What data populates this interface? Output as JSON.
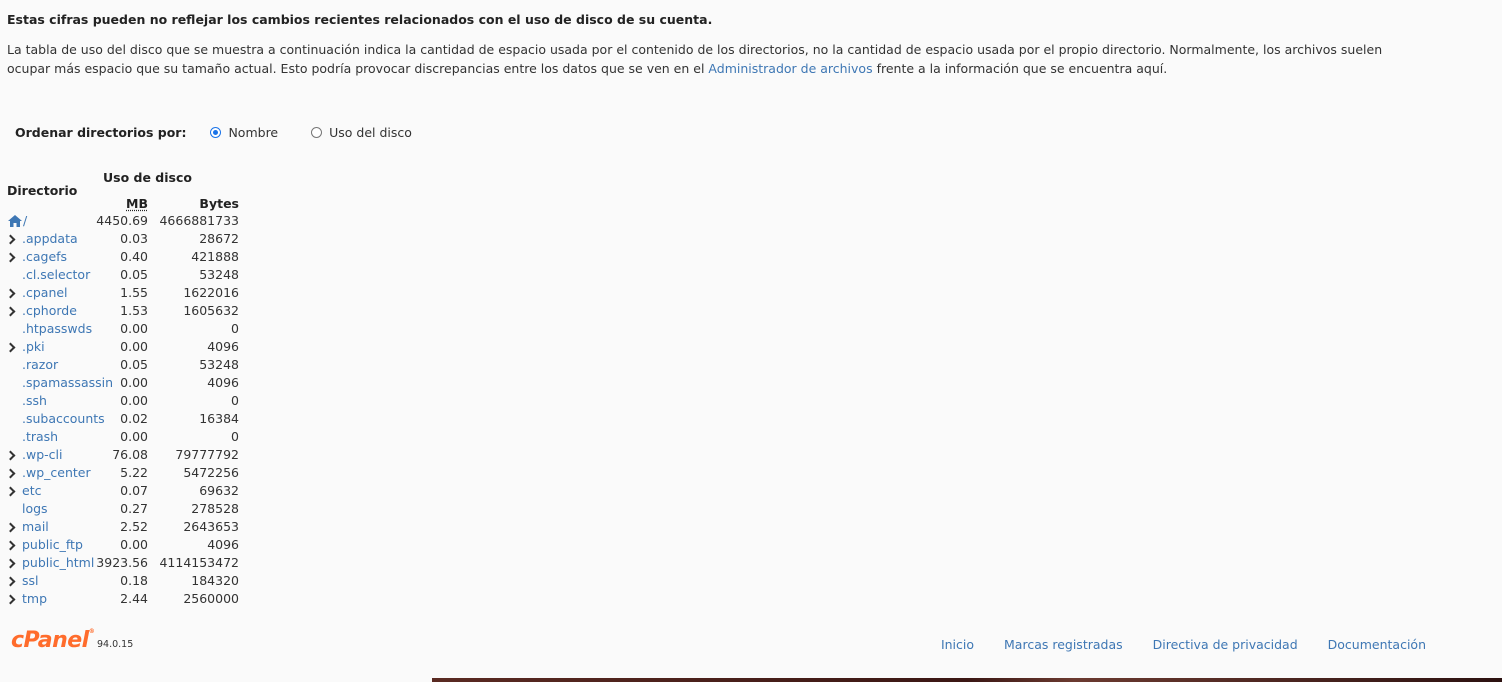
{
  "notice": "Estas cifras pueden no reflejar los cambios recientes relacionados con el uso de disco de su cuenta.",
  "description": {
    "part1": "La tabla de uso del disco que se muestra a continuación indica la cantidad de espacio usada por el contenido de los directorios, no la cantidad de espacio usada por el propio directorio. Normalmente, los archivos suelen ocupar más espacio que su tamaño actual. Esto podría provocar discrepancias entre los datos que se ven en el ",
    "link": "Administrador de archivos",
    "part2": " frente a la información que se encuentra aquí."
  },
  "sort": {
    "label": "Ordenar directorios por:",
    "options": [
      {
        "label": "Nombre",
        "checked": true
      },
      {
        "label": "Uso del disco",
        "checked": false
      }
    ]
  },
  "table": {
    "dir_header": "Directorio",
    "usage_header": "Uso de disco",
    "mb_header": "MB",
    "bytes_header": "Bytes",
    "root": {
      "name": "/",
      "mb": "4450.69",
      "bytes": "4666881733",
      "icon": "home-icon"
    },
    "rows": [
      {
        "name": ".appdata",
        "mb": "0.03",
        "bytes": "28672",
        "expandable": true
      },
      {
        "name": ".cagefs",
        "mb": "0.40",
        "bytes": "421888",
        "expandable": true
      },
      {
        "name": ".cl.selector",
        "mb": "0.05",
        "bytes": "53248",
        "expandable": false
      },
      {
        "name": ".cpanel",
        "mb": "1.55",
        "bytes": "1622016",
        "expandable": true
      },
      {
        "name": ".cphorde",
        "mb": "1.53",
        "bytes": "1605632",
        "expandable": true
      },
      {
        "name": ".htpasswds",
        "mb": "0.00",
        "bytes": "0",
        "expandable": false
      },
      {
        "name": ".pki",
        "mb": "0.00",
        "bytes": "4096",
        "expandable": true
      },
      {
        "name": ".razor",
        "mb": "0.05",
        "bytes": "53248",
        "expandable": false
      },
      {
        "name": ".spamassassin",
        "mb": "0.00",
        "bytes": "4096",
        "expandable": false
      },
      {
        "name": ".ssh",
        "mb": "0.00",
        "bytes": "0",
        "expandable": false
      },
      {
        "name": ".subaccounts",
        "mb": "0.02",
        "bytes": "16384",
        "expandable": false
      },
      {
        "name": ".trash",
        "mb": "0.00",
        "bytes": "0",
        "expandable": false
      },
      {
        "name": ".wp-cli",
        "mb": "76.08",
        "bytes": "79777792",
        "expandable": true
      },
      {
        "name": ".wp_center",
        "mb": "5.22",
        "bytes": "5472256",
        "expandable": true
      },
      {
        "name": "etc",
        "mb": "0.07",
        "bytes": "69632",
        "expandable": true
      },
      {
        "name": "logs",
        "mb": "0.27",
        "bytes": "278528",
        "expandable": false
      },
      {
        "name": "mail",
        "mb": "2.52",
        "bytes": "2643653",
        "expandable": true
      },
      {
        "name": "public_ftp",
        "mb": "0.00",
        "bytes": "4096",
        "expandable": true
      },
      {
        "name": "public_html",
        "mb": "3923.56",
        "bytes": "4114153472",
        "expandable": true
      },
      {
        "name": "ssl",
        "mb": "0.18",
        "bytes": "184320",
        "expandable": true
      },
      {
        "name": "tmp",
        "mb": "2.44",
        "bytes": "2560000",
        "expandable": true
      }
    ]
  },
  "footer": {
    "logo": "cPanel",
    "version": "94.0.15",
    "links": [
      "Inicio",
      "Marcas registradas",
      "Directiva de privacidad",
      "Documentación"
    ]
  },
  "colors": {
    "link": "#3e77b4",
    "brand": "#ff6c2c",
    "radio_accent": "#1a73e8"
  }
}
